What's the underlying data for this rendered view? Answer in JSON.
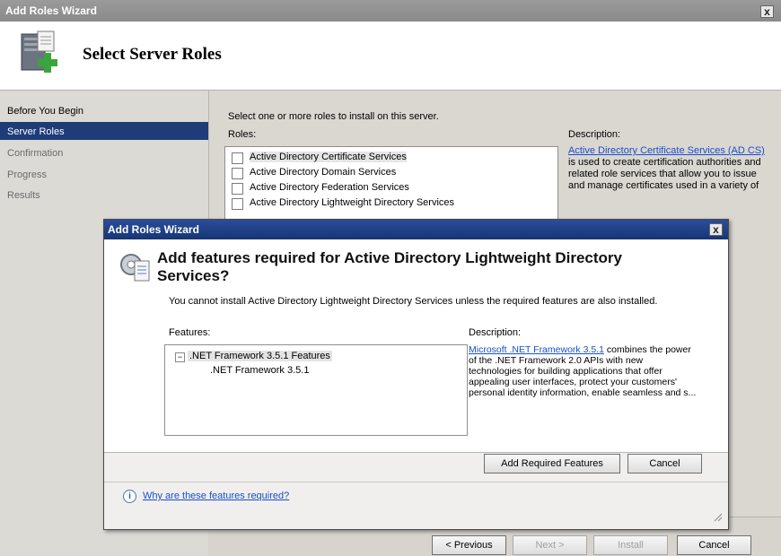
{
  "main_window": {
    "title": "Add Roles Wizard",
    "close": "x",
    "header_title": "Select Server Roles",
    "nav": [
      "Before You Begin",
      "Server Roles",
      "Confirmation",
      "Progress",
      "Results"
    ],
    "instruction": "Select one or more roles to install on this server.",
    "roles_label": "Roles:",
    "roles": [
      "Active Directory Certificate Services",
      "Active Directory Domain Services",
      "Active Directory Federation Services",
      "Active Directory Lightweight Directory Services"
    ],
    "description_label": "Description:",
    "description_link": "Active Directory Certificate Services (AD CS)",
    "description_text": "is used to create certification authorities and related role services that allow you to issue and manage certificates used in a variety of",
    "buttons": {
      "previous": "< Previous",
      "next": "Next >",
      "install": "Install",
      "cancel": "Cancel"
    }
  },
  "dialog": {
    "title": "Add Roles Wizard",
    "close": "x",
    "heading": "Add features required for Active Directory Lightweight Directory Services?",
    "message": "You cannot install Active Directory Lightweight Directory Services unless the required features are also installed.",
    "features_label": "Features:",
    "feature_tree": {
      "parent": ".NET Framework 3.5.1 Features",
      "child": ".NET Framework 3.5.1",
      "expander": "−"
    },
    "description_label": "Description:",
    "description_link": "Microsoft .NET Framework 3.5.1",
    "description_text": "combines the power of the .NET Framework 2.0 APIs with new technologies for building applications that offer appealing user interfaces, protect your customers' personal identity information, enable seamless and s...",
    "buttons": {
      "add": "Add Required Features",
      "cancel": "Cancel"
    },
    "help_link": "Why are these features required?",
    "info_glyph": "i"
  }
}
